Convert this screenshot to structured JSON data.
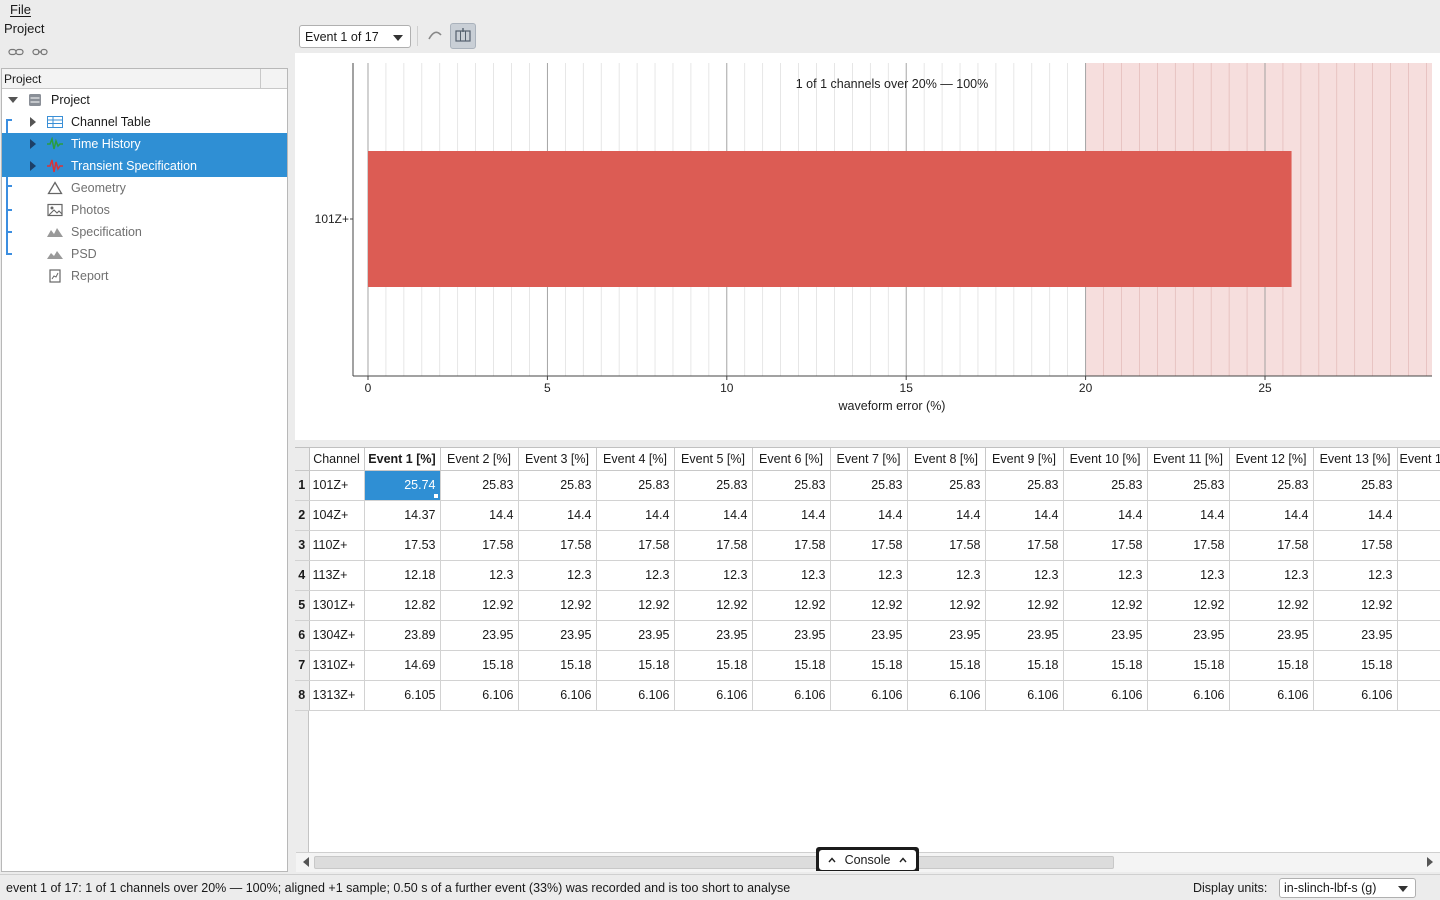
{
  "menubar": {
    "file": "File"
  },
  "left": {
    "header": "Project",
    "column_header": "Project",
    "tree": [
      {
        "label": "Project",
        "icon": "database-icon"
      },
      {
        "label": "Channel Table",
        "icon": "table-icon"
      },
      {
        "label": "Time History",
        "icon": "waveform-icon"
      },
      {
        "label": "Transient Specification",
        "icon": "waveform-red-icon"
      },
      {
        "label": "Geometry",
        "icon": "triangle-icon"
      },
      {
        "label": "Photos",
        "icon": "image-icon"
      },
      {
        "label": "Specification",
        "icon": "mountain-icon"
      },
      {
        "label": "PSD",
        "icon": "mountain-icon"
      },
      {
        "label": "Report",
        "icon": "report-icon"
      }
    ]
  },
  "toolbar": {
    "event_select": "Event 1 of 17"
  },
  "chart_data": {
    "type": "bar",
    "orientation": "horizontal",
    "categories": [
      "101Z+"
    ],
    "values": [
      25.74
    ],
    "annotation": "1 of 1 channels over 20% — 100%",
    "xlabel": "waveform error (%)",
    "ylabel": "",
    "xlim": [
      0,
      29.6
    ],
    "xticks": [
      0,
      5,
      10,
      15,
      20,
      25
    ],
    "threshold": 20,
    "grid": true,
    "colors": {
      "bar": "#dc5c54",
      "threshold_band": "#f6dedd"
    }
  },
  "table": {
    "columns": [
      "Channel",
      "Event 1 [%]",
      "Event 2 [%]",
      "Event 3 [%]",
      "Event 4 [%]",
      "Event 5 [%]",
      "Event 6 [%]",
      "Event 7 [%]",
      "Event 8 [%]",
      "Event 9 [%]",
      "Event 10 [%]",
      "Event 11 [%]",
      "Event 12 [%]",
      "Event 13 [%]",
      "Event 1"
    ],
    "rows": [
      {
        "n": "1",
        "channel": "101Z+",
        "values": [
          "25.74",
          "25.83",
          "25.83",
          "25.83",
          "25.83",
          "25.83",
          "25.83",
          "25.83",
          "25.83",
          "25.83",
          "25.83",
          "25.83",
          "25.83"
        ]
      },
      {
        "n": "2",
        "channel": "104Z+",
        "values": [
          "14.37",
          "14.4",
          "14.4",
          "14.4",
          "14.4",
          "14.4",
          "14.4",
          "14.4",
          "14.4",
          "14.4",
          "14.4",
          "14.4",
          "14.4"
        ]
      },
      {
        "n": "3",
        "channel": "110Z+",
        "values": [
          "17.53",
          "17.58",
          "17.58",
          "17.58",
          "17.58",
          "17.58",
          "17.58",
          "17.58",
          "17.58",
          "17.58",
          "17.58",
          "17.58",
          "17.58"
        ]
      },
      {
        "n": "4",
        "channel": "113Z+",
        "values": [
          "12.18",
          "12.3",
          "12.3",
          "12.3",
          "12.3",
          "12.3",
          "12.3",
          "12.3",
          "12.3",
          "12.3",
          "12.3",
          "12.3",
          "12.3"
        ]
      },
      {
        "n": "5",
        "channel": "1301Z+",
        "values": [
          "12.82",
          "12.92",
          "12.92",
          "12.92",
          "12.92",
          "12.92",
          "12.92",
          "12.92",
          "12.92",
          "12.92",
          "12.92",
          "12.92",
          "12.92"
        ]
      },
      {
        "n": "6",
        "channel": "1304Z+",
        "values": [
          "23.89",
          "23.95",
          "23.95",
          "23.95",
          "23.95",
          "23.95",
          "23.95",
          "23.95",
          "23.95",
          "23.95",
          "23.95",
          "23.95",
          "23.95"
        ]
      },
      {
        "n": "7",
        "channel": "1310Z+",
        "values": [
          "14.69",
          "15.18",
          "15.18",
          "15.18",
          "15.18",
          "15.18",
          "15.18",
          "15.18",
          "15.18",
          "15.18",
          "15.18",
          "15.18",
          "15.18"
        ]
      },
      {
        "n": "8",
        "channel": "1313Z+",
        "values": [
          "6.105",
          "6.106",
          "6.106",
          "6.106",
          "6.106",
          "6.106",
          "6.106",
          "6.106",
          "6.106",
          "6.106",
          "6.106",
          "6.106",
          "6.106"
        ]
      }
    ]
  },
  "console": {
    "label": "Console"
  },
  "status": {
    "text": "event 1 of 17: 1 of 1 channels over 20% — 100%; aligned +1 sample; 0.50 s of a further event (33%) was recorded and is too short to analyse",
    "units_label": "Display units:",
    "units_value": "in-slinch-lbf-s (g)"
  }
}
